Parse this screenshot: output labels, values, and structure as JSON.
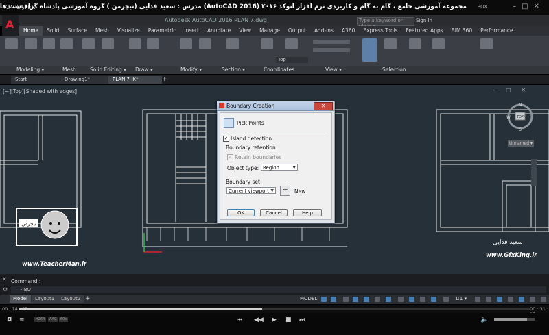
{
  "player": {
    "logo": "KMPLAYER",
    "title": "مجموعه آموزشی جامع ، گام به گام و کاربردی نرم افزار  اتوکد ۲۰۱۶ (AutoCAD 2016)   مدرس : سعید فدایی (تیچرمن ) گروه آموزشی پادشاه گرافیست ها",
    "box_label": "BOX",
    "time_current": "00 : 14 : 57",
    "time_total": "00 : 31 : 27",
    "progress": 0.4757,
    "badge1": "H264",
    "badge2": "AAC",
    "badge3": "60s"
  },
  "acad": {
    "filename": "Autodesk AutoCAD 2016   PLAN 7.dwg",
    "search_placeholder": "Type a keyword or phrase",
    "sign_in": "Sign In",
    "ribbon_tabs": [
      "Home",
      "Solid",
      "Surface",
      "Mesh",
      "Visualize",
      "Parametric",
      "Insert",
      "Annotate",
      "View",
      "Manage",
      "Output",
      "Add-ins",
      "A360",
      "Express Tools",
      "Featured Apps",
      "BIM 360",
      "Performance"
    ],
    "panels": {
      "modeling": "Modeling ▾",
      "mesh": "Mesh",
      "solid_editing": "Solid Editing ▾",
      "draw": "Draw ▾",
      "modify": "Modify ▾",
      "section": "Section ▾",
      "coordinates": "Coordinates",
      "view": "View ▾",
      "selection": "Selection"
    },
    "layer_combo": "Top",
    "file_tabs": [
      "Start",
      "Drawing1*",
      "PLAN 7 IK*"
    ],
    "viewport_label": "[−][Top][Shaded with edges]",
    "viewcube": {
      "n": "N",
      "s": "S",
      "w": "W",
      "top": "TOP",
      "unnamed": "Unnamed ▾"
    },
    "command_label": "Command :",
    "command_input": "- BO",
    "layout_tabs": [
      "Model",
      "Layout1",
      "Layout2"
    ],
    "status_model": "MODEL",
    "status_scale": "1:1 ▾"
  },
  "dialog": {
    "title": "Boundary Creation",
    "pick_points": "Pick Points",
    "island_detection": "Island detection",
    "boundary_retention": "Boundary retention",
    "retain_boundaries": "Retain boundaries",
    "object_type_label": "Object type:",
    "object_type_value": "Region",
    "boundary_set": "Boundary set",
    "boundary_set_value": "Current viewport",
    "new": "New",
    "ok": "OK",
    "cancel": "Cancel",
    "help": "Help"
  },
  "watermarks": {
    "left_site": "www.TeacherMan.ir",
    "left_name": "تیچرمن",
    "right_site": "www.GfxKing.ir",
    "right_sig": "سعید فدایی"
  },
  "colors": {
    "autocad_red": "#d9232e",
    "viewport_bg": "#263038",
    "ribbon_bg": "#3b3e44",
    "dialog_bg": "#f0f0f0"
  }
}
